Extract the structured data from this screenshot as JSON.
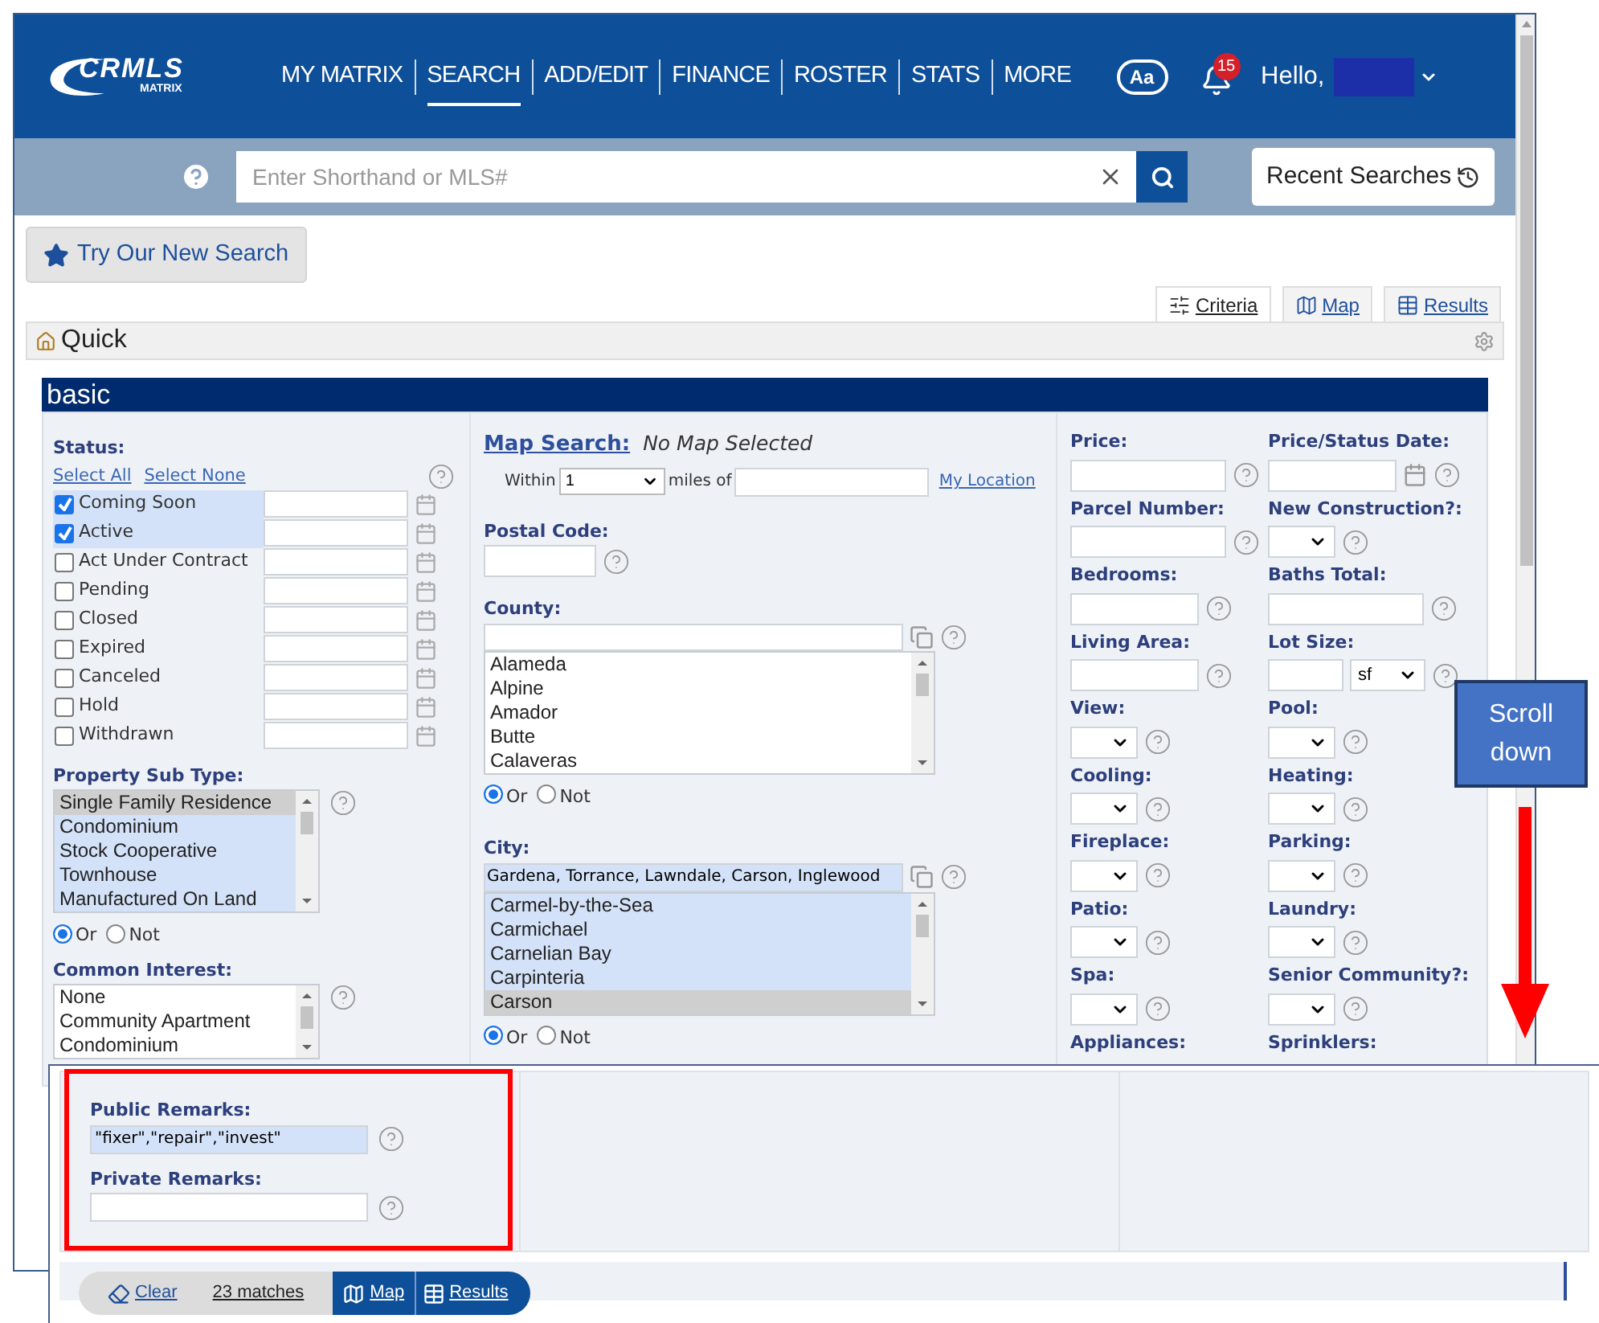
{
  "logo": {
    "name": "CRMLS",
    "sub": "MATRIX"
  },
  "nav": [
    {
      "label": "MY MATRIX",
      "selected": false
    },
    {
      "label": "SEARCH",
      "selected": true
    },
    {
      "label": "ADD/EDIT",
      "selected": false
    },
    {
      "label": "FINANCE",
      "selected": false
    },
    {
      "label": "ROSTER",
      "selected": false
    },
    {
      "label": "STATS",
      "selected": false
    },
    {
      "label": "MORE",
      "selected": false
    }
  ],
  "font_button": "Aa",
  "notification_count": "15",
  "greeting": "Hello,",
  "search": {
    "placeholder": "Enter Shorthand or MLS#",
    "recent": "Recent Searches"
  },
  "try_button": "Try Our New Search",
  "view_tabs": [
    {
      "label": "Criteria",
      "selected": true,
      "kind": "criteria"
    },
    {
      "label": "Map",
      "selected": false,
      "kind": "map"
    },
    {
      "label": "Results",
      "selected": false,
      "kind": "results"
    }
  ],
  "panel_title": "Quick",
  "section_title": "basic",
  "status": {
    "label": "Status:",
    "select_all": "Select All",
    "select_none": "Select None",
    "items": [
      {
        "label": "Coming Soon",
        "checked": true
      },
      {
        "label": "Active",
        "checked": true
      },
      {
        "label": "Act Under Contract",
        "checked": false
      },
      {
        "label": "Pending",
        "checked": false
      },
      {
        "label": "Closed",
        "checked": false
      },
      {
        "label": "Expired",
        "checked": false
      },
      {
        "label": "Canceled",
        "checked": false
      },
      {
        "label": "Hold",
        "checked": false
      },
      {
        "label": "Withdrawn",
        "checked": false
      }
    ]
  },
  "property_sub_type": {
    "label": "Property Sub Type:",
    "options": [
      {
        "label": "Single Family Residence",
        "selected": true,
        "current": true
      },
      {
        "label": "Condominium",
        "selected": true,
        "current": false
      },
      {
        "label": "Stock Cooperative",
        "selected": true,
        "current": false
      },
      {
        "label": "Townhouse",
        "selected": true,
        "current": false
      },
      {
        "label": "Manufactured On Land",
        "selected": true,
        "current": false
      }
    ],
    "logic": [
      {
        "label": "Or",
        "selected": true
      },
      {
        "label": "Not",
        "selected": false
      }
    ]
  },
  "common_interest": {
    "label": "Common Interest:",
    "options": [
      {
        "label": "None",
        "selected": false
      },
      {
        "label": "Community Apartment",
        "selected": false
      },
      {
        "label": "Condominium",
        "selected": false
      }
    ]
  },
  "map_search": {
    "label": "Map Search:",
    "note": "No Map Selected",
    "within": "Within",
    "miles": "1",
    "miles_of": "miles of",
    "my_location": "My Location"
  },
  "postal_code": {
    "label": "Postal Code:"
  },
  "county": {
    "label": "County:",
    "options": [
      {
        "label": "Alameda",
        "selected": false
      },
      {
        "label": "Alpine",
        "selected": false
      },
      {
        "label": "Amador",
        "selected": false
      },
      {
        "label": "Butte",
        "selected": false
      },
      {
        "label": "Calaveras",
        "selected": false
      }
    ],
    "logic": [
      {
        "label": "Or",
        "selected": true
      },
      {
        "label": "Not",
        "selected": false
      }
    ]
  },
  "city": {
    "label": "City:",
    "value": "Gardena, Torrance, Lawndale, Carson, Inglewood",
    "options": [
      {
        "label": "Carmel-by-the-Sea",
        "selected": true,
        "current": false
      },
      {
        "label": "Carmichael",
        "selected": true,
        "current": false
      },
      {
        "label": "Carnelian Bay",
        "selected": true,
        "current": false
      },
      {
        "label": "Carpinteria",
        "selected": true,
        "current": false
      },
      {
        "label": "Carson",
        "selected": true,
        "current": true
      }
    ],
    "logic": [
      {
        "label": "Or",
        "selected": true
      },
      {
        "label": "Not",
        "selected": false
      }
    ]
  },
  "fields": [
    {
      "label": "Price:",
      "kind": "text"
    },
    {
      "label": "Price/Status Date:",
      "kind": "date"
    },
    {
      "label": "Parcel Number:",
      "kind": "text"
    },
    {
      "label": "New Construction?:",
      "kind": "select"
    },
    {
      "label": "Bedrooms:",
      "kind": "short"
    },
    {
      "label": "Baths Total:",
      "kind": "wide"
    },
    {
      "label": "Living Area:",
      "kind": "short"
    },
    {
      "label": "Lot Size:",
      "kind": "lot",
      "unit": "sf"
    },
    {
      "label": "View:",
      "kind": "select"
    },
    {
      "label": "Pool:",
      "kind": "select"
    },
    {
      "label": "Cooling:",
      "kind": "select"
    },
    {
      "label": "Heating:",
      "kind": "select"
    },
    {
      "label": "Fireplace:",
      "kind": "select"
    },
    {
      "label": "Parking:",
      "kind": "select"
    },
    {
      "label": "Patio:",
      "kind": "select"
    },
    {
      "label": "Laundry:",
      "kind": "select"
    },
    {
      "label": "Spa:",
      "kind": "select"
    },
    {
      "label": "Senior Community?:",
      "kind": "select"
    },
    {
      "label": "Appliances:",
      "kind": "cut"
    },
    {
      "label": "Sprinklers:",
      "kind": "cut"
    }
  ],
  "remarks": [
    {
      "label": "Public Remarks:",
      "value": "\"fixer\",\"repair\",\"invest\"",
      "filled": true
    },
    {
      "label": "Private Remarks:",
      "filled": false
    }
  ],
  "bottom_bar": {
    "clear": "Clear",
    "matches": "23 matches",
    "map": "Map",
    "results": "Results"
  },
  "callout": "Scroll down"
}
